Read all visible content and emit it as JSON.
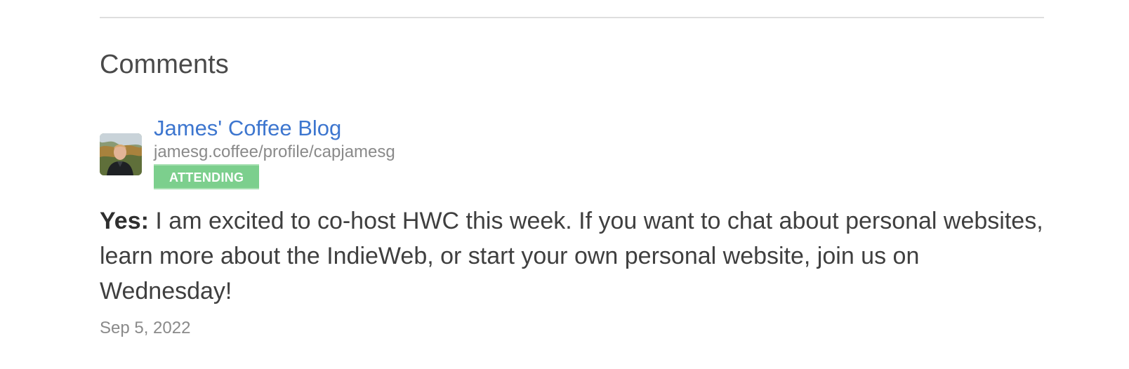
{
  "section": {
    "title": "Comments"
  },
  "comment": {
    "author_name": "James' Coffee Blog",
    "author_url": "jamesg.coffee/profile/capjamesg",
    "rsvp_badge": "ATTENDING",
    "rsvp_label": "Yes:",
    "text": " I am excited to co-host HWC this week. If you want to chat about personal websites, learn more about the IndieWeb, or start your own personal website, join us on Wednesday!",
    "date": "Sep 5, 2022",
    "avatar_icon": "user-photo-avatar"
  },
  "colors": {
    "link": "#3d76cf",
    "badge_bg": "#7ccf8d",
    "muted_text": "#8a8a8a",
    "divider": "#dedede"
  }
}
